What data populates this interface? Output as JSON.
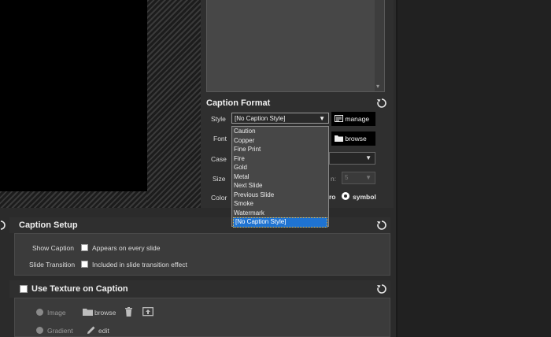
{
  "caption_format": {
    "title": "Caption Format",
    "style_label": "Style",
    "style_selected": "[No Caption Style]",
    "manage_label": "manage",
    "font_label": "Font",
    "browse_label": "browse",
    "case_label": "Case",
    "size_label": "Size",
    "size_value_label": "n:",
    "size_value": "5",
    "color_label": "Color",
    "partial_text": "ro",
    "symbol_label": "symbol",
    "style_options": [
      "Caution",
      "Copper",
      "Fine Print",
      "Fire",
      "Gold",
      "Metal",
      "Next Slide",
      "Previous Slide",
      "Smoke",
      "Watermark",
      "[No Caption Style]"
    ]
  },
  "caption_setup": {
    "title": "Caption Setup",
    "show_caption_label": "Show Caption",
    "show_caption_check": "Appears on every slide",
    "slide_transition_label": "Slide Transition",
    "slide_transition_check": "Included in slide transition effect"
  },
  "texture": {
    "title": "Use Texture on Caption",
    "image_label": "Image",
    "browse_label": "browse",
    "gradient_label": "Gradient",
    "edit_label": "edit"
  },
  "colors": {
    "selection": "#1f73d1",
    "panel": "#3b3b3b",
    "background": "#2b2b2b"
  }
}
